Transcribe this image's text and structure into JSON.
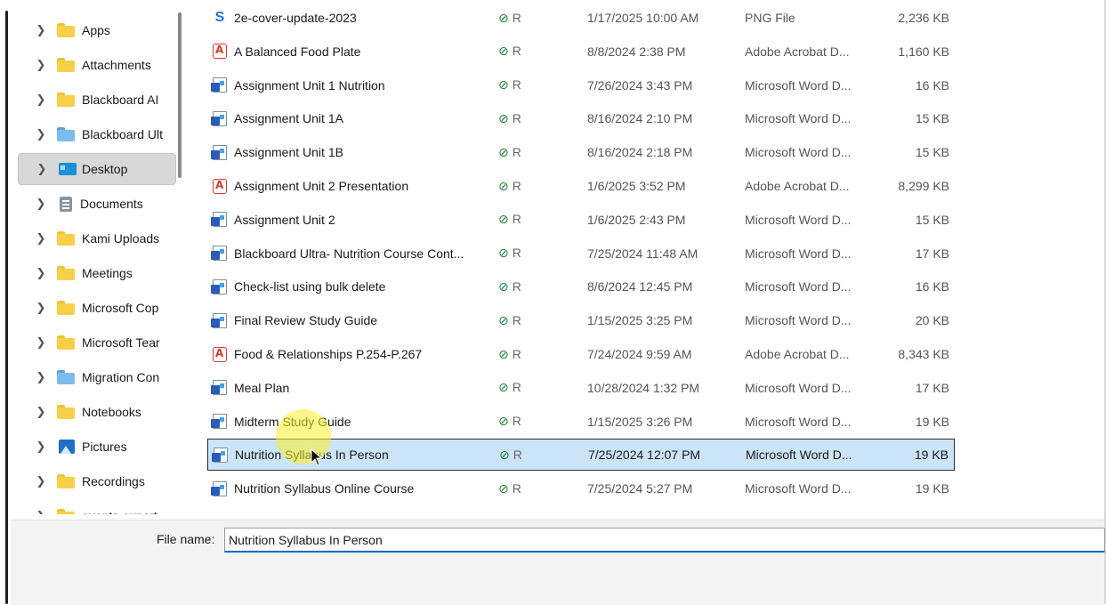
{
  "sidebar": {
    "items": [
      {
        "label": "Apps",
        "icon": "folder-yellow-icon"
      },
      {
        "label": "Attachments",
        "icon": "folder-yellow-icon"
      },
      {
        "label": "Blackboard AI",
        "icon": "folder-yellow-icon"
      },
      {
        "label": "Blackboard Ult",
        "icon": "folder-blue-icon"
      },
      {
        "label": "Desktop",
        "icon": "desktop-icon",
        "selected": true
      },
      {
        "label": "Documents",
        "icon": "documents-icon"
      },
      {
        "label": "Kami Uploads",
        "icon": "folder-yellow-icon"
      },
      {
        "label": "Meetings",
        "icon": "folder-yellow-icon"
      },
      {
        "label": "Microsoft Cop",
        "icon": "folder-yellow-icon"
      },
      {
        "label": "Microsoft Tear",
        "icon": "folder-yellow-icon"
      },
      {
        "label": "Migration Con",
        "icon": "folder-blue-icon"
      },
      {
        "label": "Notebooks",
        "icon": "folder-yellow-icon"
      },
      {
        "label": "Pictures",
        "icon": "pictures-icon"
      },
      {
        "label": "Recordings",
        "icon": "folder-yellow-icon"
      },
      {
        "label": "events-export",
        "icon": "folder-yellow-icon"
      }
    ]
  },
  "files": [
    {
      "name": "2e-cover-update-2023",
      "type_icon": "png",
      "date": "1/17/2025 10:00 AM",
      "type": "PNG File",
      "size": "2,236 KB"
    },
    {
      "name": "A Balanced Food Plate",
      "type_icon": "pdf",
      "date": "8/8/2024 2:38 PM",
      "type": "Adobe Acrobat D...",
      "size": "1,160 KB"
    },
    {
      "name": "Assignment Unit 1 Nutrition",
      "type_icon": "word",
      "date": "7/26/2024 3:43 PM",
      "type": "Microsoft Word D...",
      "size": "16 KB"
    },
    {
      "name": "Assignment Unit 1A",
      "type_icon": "word",
      "date": "8/16/2024 2:10 PM",
      "type": "Microsoft Word D...",
      "size": "15 KB"
    },
    {
      "name": "Assignment Unit 1B",
      "type_icon": "word",
      "date": "8/16/2024 2:18 PM",
      "type": "Microsoft Word D...",
      "size": "15 KB"
    },
    {
      "name": "Assignment Unit 2 Presentation",
      "type_icon": "pdf",
      "date": "1/6/2025 3:52 PM",
      "type": "Adobe Acrobat D...",
      "size": "8,299 KB"
    },
    {
      "name": "Assignment Unit 2",
      "type_icon": "word",
      "date": "1/6/2025 2:43 PM",
      "type": "Microsoft Word D...",
      "size": "15 KB"
    },
    {
      "name": "Blackboard Ultra- Nutrition Course Cont...",
      "type_icon": "word",
      "date": "7/25/2024 11:48 AM",
      "type": "Microsoft Word D...",
      "size": "17 KB"
    },
    {
      "name": "Check-list using bulk delete",
      "type_icon": "word",
      "date": "8/6/2024 12:45 PM",
      "type": "Microsoft Word D...",
      "size": "16 KB"
    },
    {
      "name": "Final Review Study Guide",
      "type_icon": "word",
      "date": "1/15/2025 3:25 PM",
      "type": "Microsoft Word D...",
      "size": "20 KB"
    },
    {
      "name": "Food & Relationships P.254-P.267",
      "type_icon": "pdf",
      "date": "7/24/2024 9:59 AM",
      "type": "Adobe Acrobat D...",
      "size": "8,343 KB"
    },
    {
      "name": "Meal Plan",
      "type_icon": "word",
      "date": "10/28/2024 1:32 PM",
      "type": "Microsoft Word D...",
      "size": "17 KB"
    },
    {
      "name": "Midterm Study Guide",
      "type_icon": "word",
      "date": "1/15/2025 3:26 PM",
      "type": "Microsoft Word D...",
      "size": "19 KB"
    },
    {
      "name": "Nutrition Syllabus In Person",
      "type_icon": "word",
      "date": "7/25/2024 12:07 PM",
      "type": "Microsoft Word D...",
      "size": "19 KB",
      "selected": true
    },
    {
      "name": "Nutrition Syllabus Online Course",
      "type_icon": "word",
      "date": "7/25/2024 5:27 PM",
      "type": "Microsoft Word D...",
      "size": "19 KB"
    }
  ],
  "status_glyphs": {
    "synced": "⊘",
    "shared": "R"
  },
  "bottom": {
    "file_name_label": "File name:",
    "file_name_value": "Nutrition Syllabus In Person"
  },
  "colors": {
    "selection": "#cce4f7",
    "nav_selected": "#d8d8d8",
    "accent": "#0067c0",
    "status_green": "#1a7f37"
  }
}
